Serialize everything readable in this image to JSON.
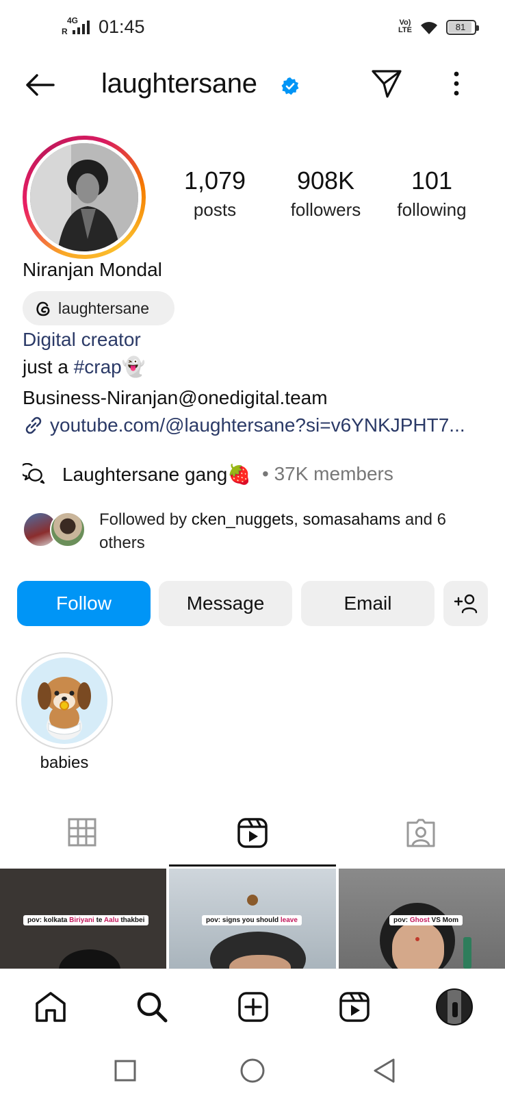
{
  "status_bar": {
    "time": "01:45",
    "network": "4G",
    "roaming": "R",
    "volte": "Vo) LTE",
    "battery": "81"
  },
  "header": {
    "username": "laughtersane",
    "verified": true,
    "back_icon": "arrow-left-icon",
    "dm_icon": "paper-plane-icon",
    "menu_icon": "more-vertical-icon"
  },
  "profile": {
    "stats": [
      {
        "value": "1,079",
        "label": "posts"
      },
      {
        "value": "908K",
        "label": "followers"
      },
      {
        "value": "101",
        "label": "following"
      }
    ],
    "full_name": "Niranjan Mondal",
    "threads_handle": "laughtersane",
    "category": "Digital creator",
    "bio_text": "just a ",
    "bio_hashtag": "#crap",
    "bio_emoji": "👻",
    "email": "Business-Niranjan@onedigital.team",
    "link": "youtube.com/@laughtersane?si=v6YNKJPHT7..."
  },
  "channel": {
    "name": "Laughtersane gang",
    "emoji": "🍓",
    "members": "• 37K members"
  },
  "mutual": {
    "prefix": "Followed by ",
    "user1": "cken_nuggets",
    "separator": ", ",
    "user2": "somasahams",
    "suffix": " and 6 others"
  },
  "actions": {
    "follow": "Follow",
    "message": "Message",
    "email": "Email"
  },
  "highlights": [
    {
      "label": "babies"
    }
  ],
  "tabs": [
    "grid",
    "reels",
    "tagged"
  ],
  "reels": [
    {
      "caption_pre": "pov: kolkata ",
      "caption_hl1": "Biriyani",
      "caption_mid": " te ",
      "caption_hl2": "Aalu",
      "caption_post": " thakbei"
    },
    {
      "caption_pre": "pov: signs you should ",
      "caption_hl1": "leave",
      "caption_mid": "",
      "caption_hl2": "",
      "caption_post": ""
    },
    {
      "caption_pre": "pov: ",
      "caption_hl1": "Ghost",
      "caption_mid": " VS Mom",
      "caption_hl2": "",
      "caption_post": ""
    }
  ],
  "colors": {
    "accent": "#0095f6",
    "link": "#2b3a67",
    "muted": "#777777"
  }
}
